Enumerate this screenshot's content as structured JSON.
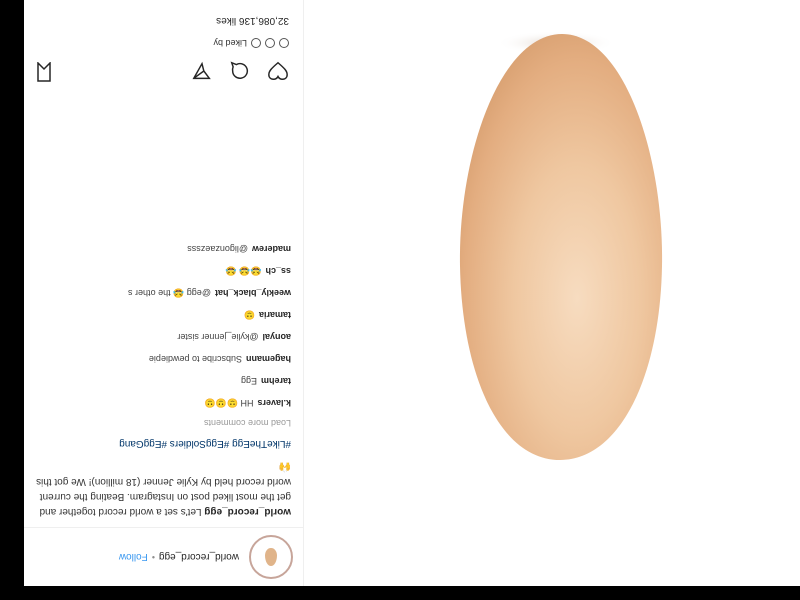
{
  "post": {
    "username": "world_record_egg",
    "verified_glyph": "✔",
    "dot": "•",
    "follow_label": "Follow",
    "caption": "Let's set a world record together and get the most liked post on Instagram. Beating the current world record held by Kylie Jenner (18 million)! We got this",
    "caption_emoji": "🙌",
    "hashtags": "#LikeTheEgg #EggSoldiers #EggGang",
    "view_replies": "Load more comments",
    "comments": [
      {
        "user": "k.lavers",
        "text": "HH 🙂🙂🙂"
      },
      {
        "user": "tarehm",
        "text": "Egg"
      },
      {
        "user": "hagemann",
        "text": "Subscribe to pewdiepie"
      },
      {
        "user": "aonyal",
        "text": "@kylie_jenner sister"
      },
      {
        "user": "tamaria",
        "text": "🙂"
      },
      {
        "user": "weekly_black_hat",
        "text": "@egg 😂 the other s"
      },
      {
        "user": "ss_ch",
        "text": "😂😂 😂"
      },
      {
        "user": "maderew",
        "text": "@ligonzaezsss"
      }
    ],
    "liked_by": "Liked by",
    "likes_count": "32,086,136 likes"
  },
  "icons": [
    "heart-icon",
    "comment-icon",
    "share-icon",
    "bookmark-icon",
    "egg-avatar-icon"
  ],
  "colors": {
    "egg_light": "#f4d2b2",
    "egg_mid": "#e8b78e",
    "egg_dark": "#d59d6f",
    "link": "#3897f0",
    "background": "#ffffff"
  }
}
